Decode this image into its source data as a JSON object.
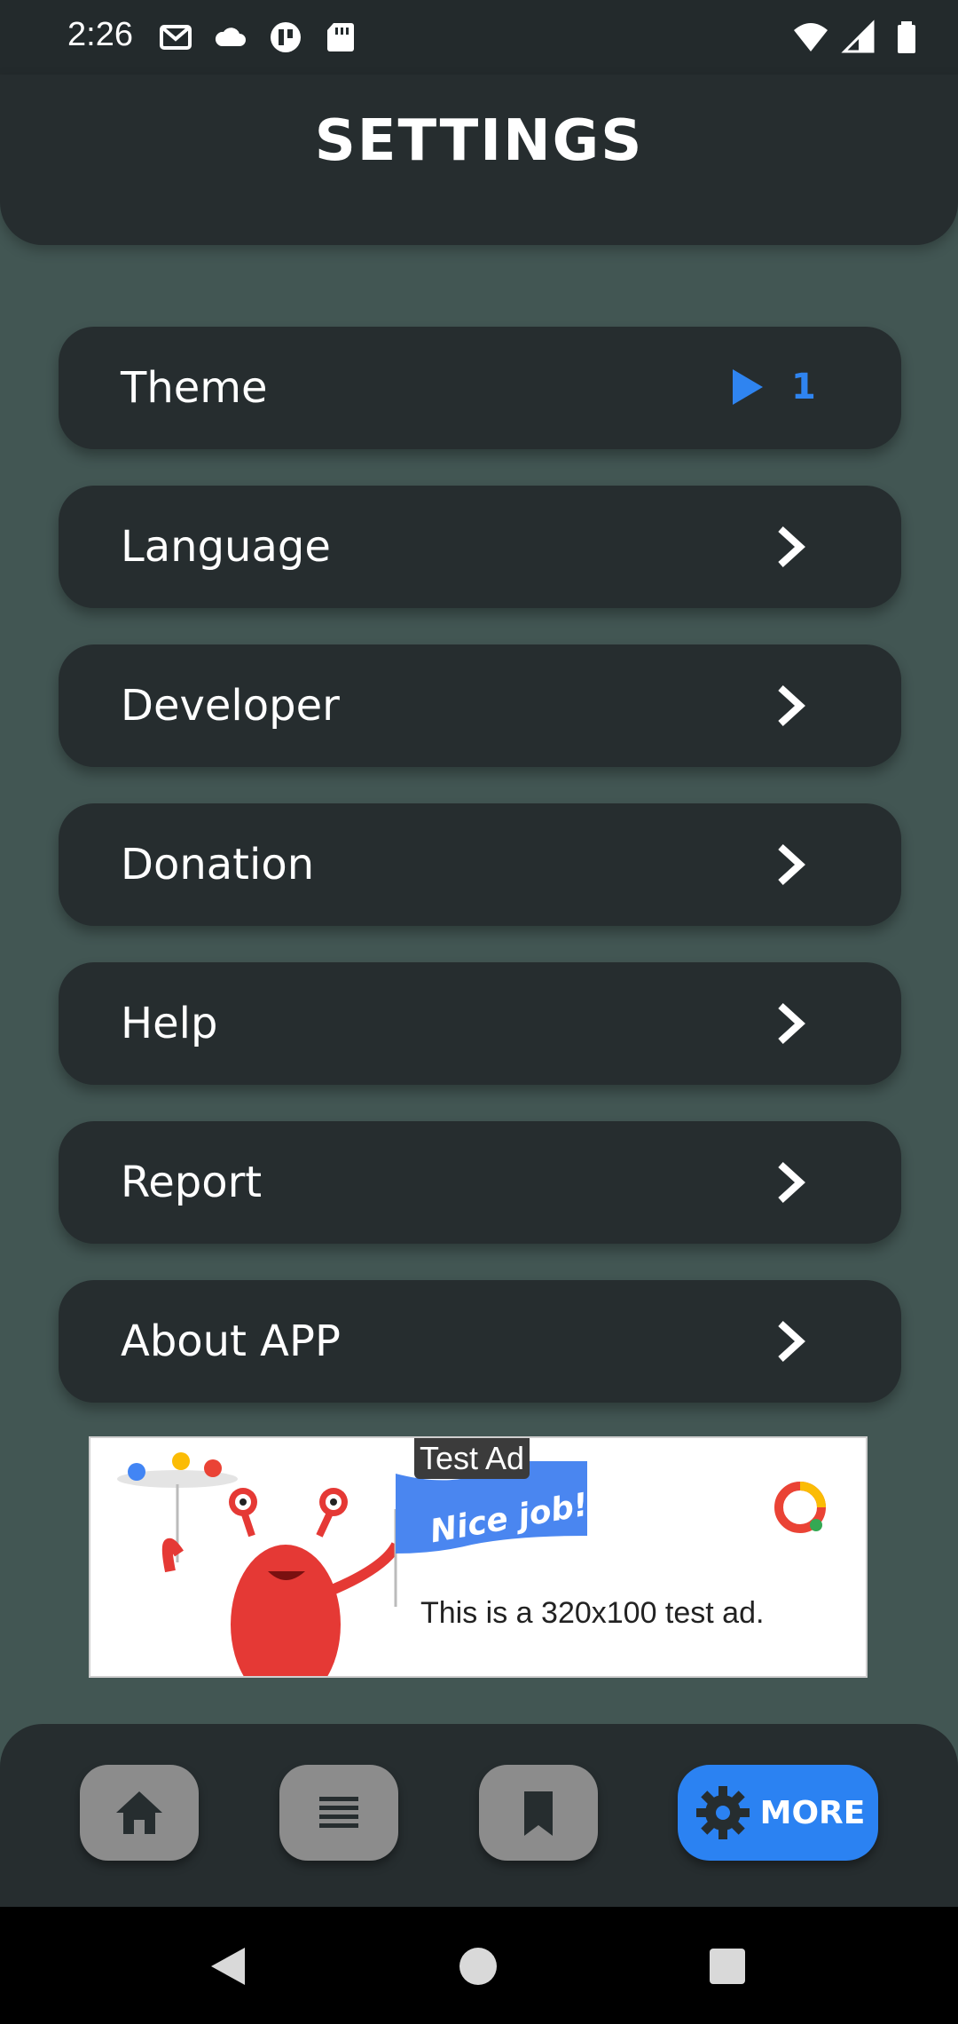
{
  "status_bar": {
    "time": "2:26",
    "left_icons": [
      "gmail-icon",
      "cloud-icon",
      "app-icon",
      "sd-card-icon"
    ],
    "right_icons": [
      "wifi-icon",
      "signal-icon",
      "battery-icon"
    ]
  },
  "header": {
    "title": "SETTINGS"
  },
  "menu": {
    "items": [
      {
        "label": "Theme",
        "value": "1"
      },
      {
        "label": "Language"
      },
      {
        "label": "Developer"
      },
      {
        "label": "Donation"
      },
      {
        "label": "Help"
      },
      {
        "label": "Report"
      },
      {
        "label": "About APP"
      }
    ]
  },
  "ad": {
    "badge": "Test Ad",
    "flag_text": "Nice job!",
    "body": "This is a 320x100 test ad."
  },
  "bottom_nav": {
    "items": [
      "home-icon",
      "list-icon",
      "bookmark-icon",
      "gear-icon"
    ],
    "more_label": "MORE"
  },
  "colors": {
    "background": "#425653",
    "card": "#262d2f",
    "accent": "#2b82f2"
  }
}
